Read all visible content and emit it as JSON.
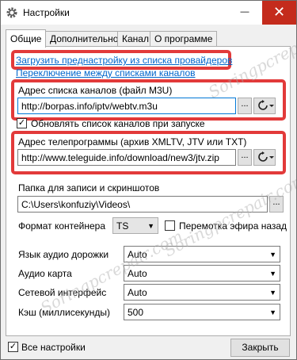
{
  "window": {
    "title": "Настройки",
    "minimize_symbol": "—",
    "close_symbol": "✕"
  },
  "tabs": [
    {
      "label": "Общие"
    },
    {
      "label": "Дополнительно"
    },
    {
      "label": "Канал"
    },
    {
      "label": "О программе"
    }
  ],
  "general": {
    "preset_link": "Загрузить преднастройку из списка провайдеров",
    "switch_link": "Переключение между списками каналов",
    "playlist": {
      "label": "Адрес списка каналов (файл M3U)",
      "value": "http://borpas.info/iptv/webtv.m3u",
      "browse": "..."
    },
    "update_on_start": {
      "label": "Обновлять список каналов при запуске",
      "checked": true
    },
    "epg": {
      "label": "Адрес телепрограммы (архив XMLTV, JTV или TXT)",
      "value": "http://www.teleguide.info/download/new3/jtv.zip",
      "browse": "..."
    },
    "record_folder": {
      "label": "Папка для записи и скриншотов",
      "value": "C:\\Users\\konfuziy\\Videos\\",
      "browse": "..."
    },
    "container": {
      "label": "Формат контейнера",
      "value": "TS"
    },
    "rewind": {
      "label": "Перемотка эфира назад",
      "checked": false
    },
    "audio_track": {
      "label": "Язык аудио дорожки",
      "value": "Auto"
    },
    "audio_card": {
      "label": "Аудио карта",
      "value": "Auto"
    },
    "net_iface": {
      "label": "Сетевой интерфейс",
      "value": "Auto"
    },
    "cache": {
      "label": "Кэш (миллисекунды)",
      "value": "500"
    }
  },
  "footer": {
    "all_settings": {
      "label": "Все настройки",
      "checked": true
    },
    "close_label": "Закрыть"
  },
  "watermark": "Soringpcrepair.com",
  "colors": {
    "highlight": "#e23a3a",
    "link": "#0066cc",
    "close_bg": "#c42b1c"
  }
}
